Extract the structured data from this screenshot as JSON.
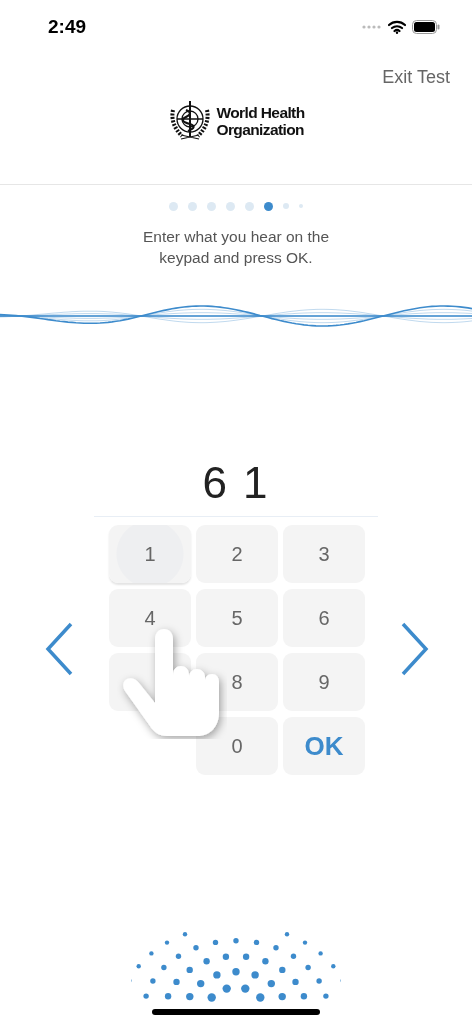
{
  "status_bar": {
    "time": "2:49"
  },
  "header": {
    "exit": "Exit Test",
    "logo_line_1": "World Health",
    "logo_line_2": "Organization"
  },
  "progress": [
    {
      "selected": false
    },
    {
      "selected": false
    },
    {
      "selected": false
    },
    {
      "selected": false
    },
    {
      "selected": false
    },
    {
      "selected": true
    },
    {
      "selected": false
    },
    {
      "selected": false
    }
  ],
  "instruction": "Enter what you hear on the keypad and press OK.",
  "entry": "6 1",
  "keys": [
    {
      "kind": "digit",
      "label": "1",
      "pressed": true
    },
    {
      "kind": "digit",
      "label": "2",
      "pressed": false
    },
    {
      "kind": "digit",
      "label": "3",
      "pressed": false
    },
    {
      "kind": "digit",
      "label": "4",
      "pressed": false
    },
    {
      "kind": "digit",
      "label": "5",
      "pressed": false
    },
    {
      "kind": "digit",
      "label": "6",
      "pressed": false
    },
    {
      "kind": "covered",
      "pressed": false
    },
    {
      "kind": "digit",
      "label": "8",
      "pressed": false
    },
    {
      "kind": "digit",
      "label": "9",
      "pressed": false
    },
    {
      "kind": "empty"
    },
    {
      "kind": "digit",
      "label": "0",
      "pressed": false
    },
    {
      "kind": "ok",
      "label": "OK",
      "pressed": false
    }
  ]
}
